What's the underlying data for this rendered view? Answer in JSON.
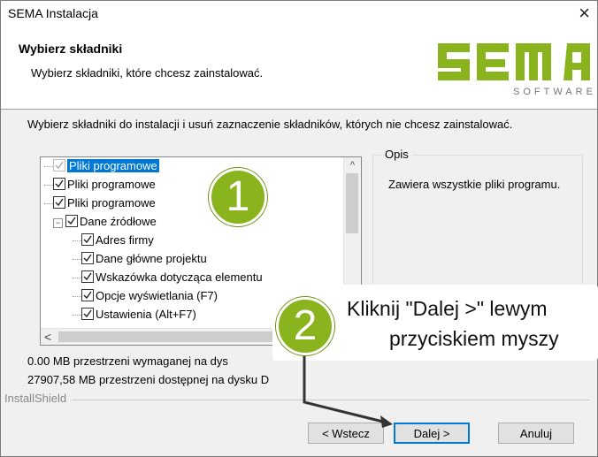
{
  "window": {
    "title": "SEMA Instalacja",
    "close_glyph": "×"
  },
  "header": {
    "title": "Wybierz składniki",
    "subtitle": "Wybierz składniki, które chcesz zainstalować."
  },
  "logo": {
    "text": "SEMA",
    "sub": "SOFTWARE",
    "color": "#8ab41e"
  },
  "description": "Wybierz składniki do instalacji i usuń zaznaczenie składników, których nie chcesz zainstalować.",
  "tree": {
    "items": [
      {
        "label": "Pliki programowe",
        "checked": true,
        "level": 0,
        "selected": true,
        "grey": true
      },
      {
        "label": "Pliki programowe",
        "checked": true,
        "level": 0
      },
      {
        "label": "Pliki programowe",
        "checked": true,
        "level": 0
      },
      {
        "label": "Dane źródłowe",
        "checked": true,
        "level": 0,
        "expander": "−"
      },
      {
        "label": "Adres firmy",
        "checked": true,
        "level": 1
      },
      {
        "label": "Dane główne projektu",
        "checked": true,
        "level": 1
      },
      {
        "label": "Wskazówka dotycząca elementu",
        "checked": true,
        "level": 1
      },
      {
        "label": "Opcje wyświetlania (F7)",
        "checked": true,
        "level": 1
      },
      {
        "label": "Ustawienia (Alt+F7)",
        "checked": true,
        "level": 1
      }
    ],
    "scroll_up_glyph": "^",
    "scroll_left_glyph": "<"
  },
  "opis": {
    "legend": "Opis",
    "text": "Zawiera wszystkie pliki programu."
  },
  "space": {
    "required": "0.00 MB przestrzeni wymaganej na dys",
    "available": "27907,58 MB przestrzeni dostępnej na dysku D"
  },
  "installshield": "InstallShield",
  "buttons": {
    "back": "< Wstecz",
    "next": "Dalej >",
    "cancel": "Anuluj"
  },
  "annotations": {
    "badge1": "1",
    "badge2": "2",
    "callout_line1": "Kliknij \"Dalej >\" lewym",
    "callout_line2": "przyciskiem myszy",
    "accent": "#8ab41e"
  }
}
